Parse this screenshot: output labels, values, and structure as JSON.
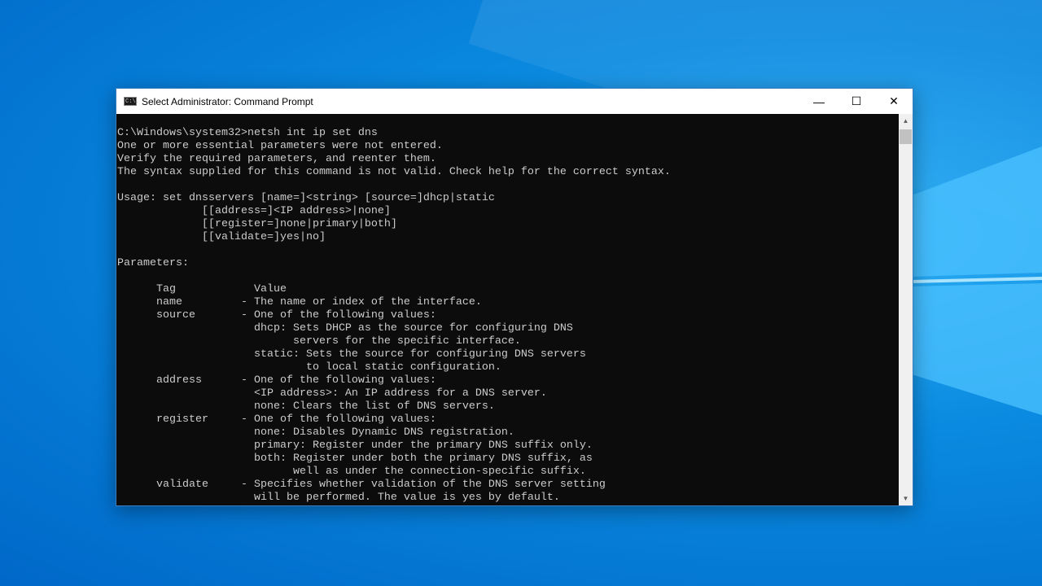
{
  "window": {
    "title": "Select Administrator: Command Prompt",
    "icon": "cmd-icon",
    "icon_text": "C:\\."
  },
  "controls": {
    "minimize": "—",
    "maximize": "☐",
    "close": "✕"
  },
  "console_lines": [
    "C:\\Windows\\system32>netsh int ip set dns",
    "One or more essential parameters were not entered.",
    "Verify the required parameters, and reenter them.",
    "The syntax supplied for this command is not valid. Check help for the correct syntax.",
    "",
    "Usage: set dnsservers [name=]<string> [source=]dhcp|static",
    "             [[address=]<IP address>|none]",
    "             [[register=]none|primary|both]",
    "             [[validate=]yes|no]",
    "",
    "Parameters:",
    "",
    "      Tag            Value",
    "      name         - The name or index of the interface.",
    "      source       - One of the following values:",
    "                     dhcp: Sets DHCP as the source for configuring DNS",
    "                           servers for the specific interface.",
    "                     static: Sets the source for configuring DNS servers",
    "                             to local static configuration.",
    "      address      - One of the following values:",
    "                     <IP address>: An IP address for a DNS server.",
    "                     none: Clears the list of DNS servers.",
    "      register     - One of the following values:",
    "                     none: Disables Dynamic DNS registration.",
    "                     primary: Register under the primary DNS suffix only.",
    "                     both: Register under both the primary DNS suffix, as",
    "                           well as under the connection-specific suffix.",
    "      validate     - Specifies whether validation of the DNS server setting",
    "                     will be performed. The value is yes by default."
  ],
  "scrollbar": {
    "up": "▲",
    "down": "▼"
  }
}
